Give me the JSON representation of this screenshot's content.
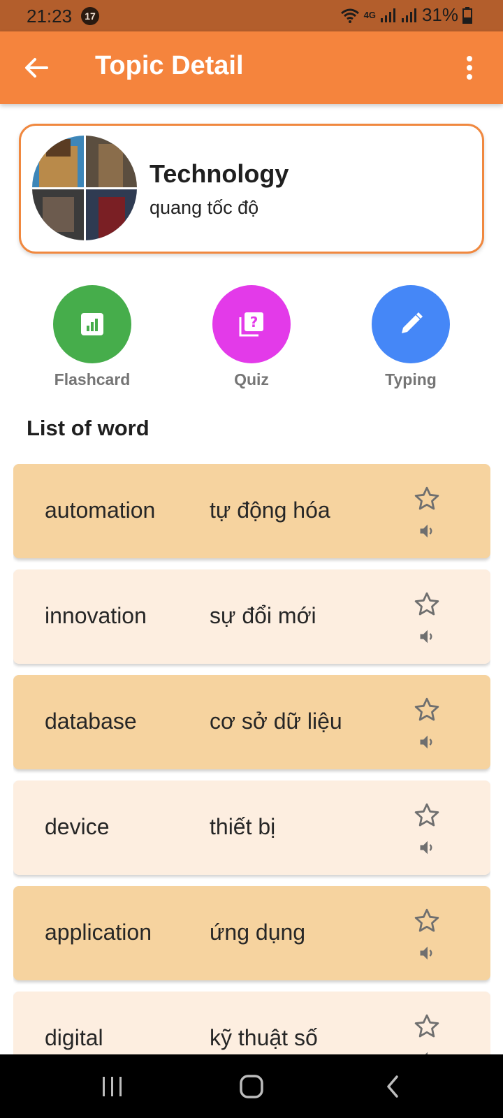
{
  "status_bar": {
    "time": "21:23",
    "notification_count": "17",
    "network": "4G",
    "battery": "31%"
  },
  "app_bar": {
    "title": "Topic Detail",
    "back_icon": "arrow-left-icon",
    "menu_icon": "more-vertical-icon"
  },
  "topic": {
    "name": "Technology",
    "subtitle": "quang tốc độ",
    "avatar": "topic-collage-image"
  },
  "modes": [
    {
      "label": "Flashcard",
      "icon": "flashcard-icon",
      "color": "#46ad4b"
    },
    {
      "label": "Quiz",
      "icon": "quiz-icon",
      "color": "#e33ae9"
    },
    {
      "label": "Typing",
      "icon": "pencil-icon",
      "color": "#4587f7"
    }
  ],
  "section_title": "List of word",
  "words": [
    {
      "en": "automation",
      "vi": "tự động hóa"
    },
    {
      "en": "innovation",
      "vi": "sự đổi mới"
    },
    {
      "en": "database",
      "vi": "cơ sở dữ liệu"
    },
    {
      "en": "device",
      "vi": "thiết bị"
    },
    {
      "en": "application",
      "vi": "ứng dụng"
    },
    {
      "en": "digital",
      "vi": "kỹ thuật số"
    }
  ],
  "colors": {
    "primary": "#f5843d",
    "status_bar": "#b35e2c",
    "row_dark": "#f6d39f",
    "row_light": "#fdeee0"
  },
  "nav_bar": {
    "icons": [
      "recent-apps-icon",
      "home-icon",
      "back-icon"
    ]
  }
}
